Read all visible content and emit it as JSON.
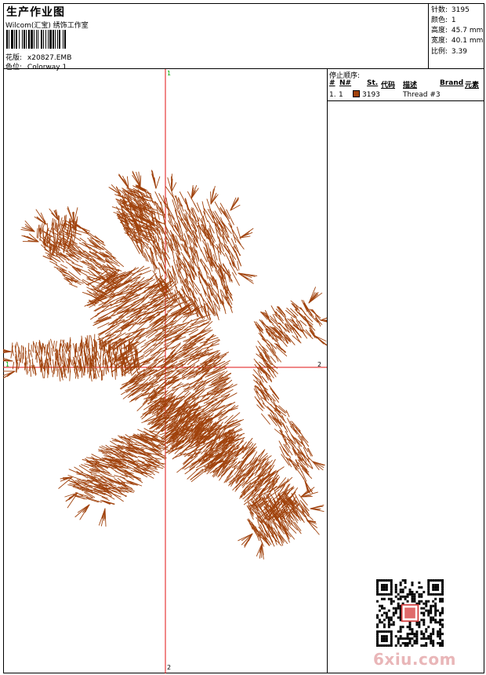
{
  "header": {
    "title": "生产作业图",
    "company": "Wilcom(汇宝) 绣饰工作室",
    "design_label": "花版:",
    "design_value": "x20827.EMB",
    "colorway_label": "色位:",
    "colorway_value": "Colorway 1"
  },
  "stats": [
    {
      "label": "针数:",
      "value": "3195"
    },
    {
      "label": "颜色:",
      "value": "1"
    },
    {
      "label": "高度:",
      "value": "45.7 mm"
    },
    {
      "label": "宽度:",
      "value": "40.1 mm"
    },
    {
      "label": "比例:",
      "value": "3.39"
    }
  ],
  "stop_sequence": {
    "title": "停止顺序:",
    "columns": {
      "num": "#",
      "n": "N#",
      "st": "St.",
      "code": "代码",
      "desc": "描述",
      "brand": "Brand",
      "element": "元素"
    },
    "rows": [
      {
        "num": "1.",
        "n": "1",
        "code": "3193",
        "desc": "Thread #3",
        "color": "#a0420c"
      }
    ]
  },
  "axes": {
    "v_top": "1",
    "v_bottom": "2",
    "h_left": "1",
    "h_right": "2"
  },
  "colors": {
    "thread": "#a0420c",
    "axis": "#e01010",
    "axis_label": "#00aa00"
  },
  "watermark": "6xiu.com",
  "icons": [
    "barcode-icon",
    "qr-code-icon",
    "lion-embroidery-icon"
  ]
}
